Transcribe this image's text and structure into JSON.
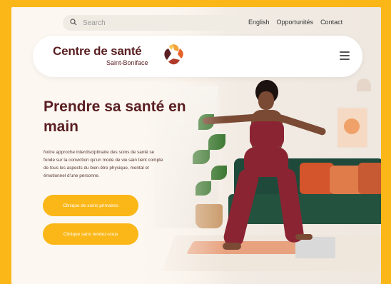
{
  "topbar": {
    "search_placeholder": "Search",
    "links": [
      "English",
      "Opportunités",
      "Contact"
    ]
  },
  "header": {
    "logo_title": "Centre de santé",
    "logo_subtitle": "Saint-Boniface",
    "logo_icon": "hands-circle-logo",
    "menu_icon": "hamburger-menu-icon"
  },
  "hero": {
    "title": "Prendre sa santé en main",
    "description": "Notre approche interdisciplinaire des soins de santé se fonde sur la conviction qu'un mode de vie sain tient compte de tous les aspects du bien-être physique, mental et émotionnel d'une personne.",
    "buttons": [
      "Clinique de soins primaires",
      "Clinique sans rendez-vous"
    ]
  },
  "colors": {
    "accent": "#fbb718",
    "brand": "#5a1f22"
  }
}
